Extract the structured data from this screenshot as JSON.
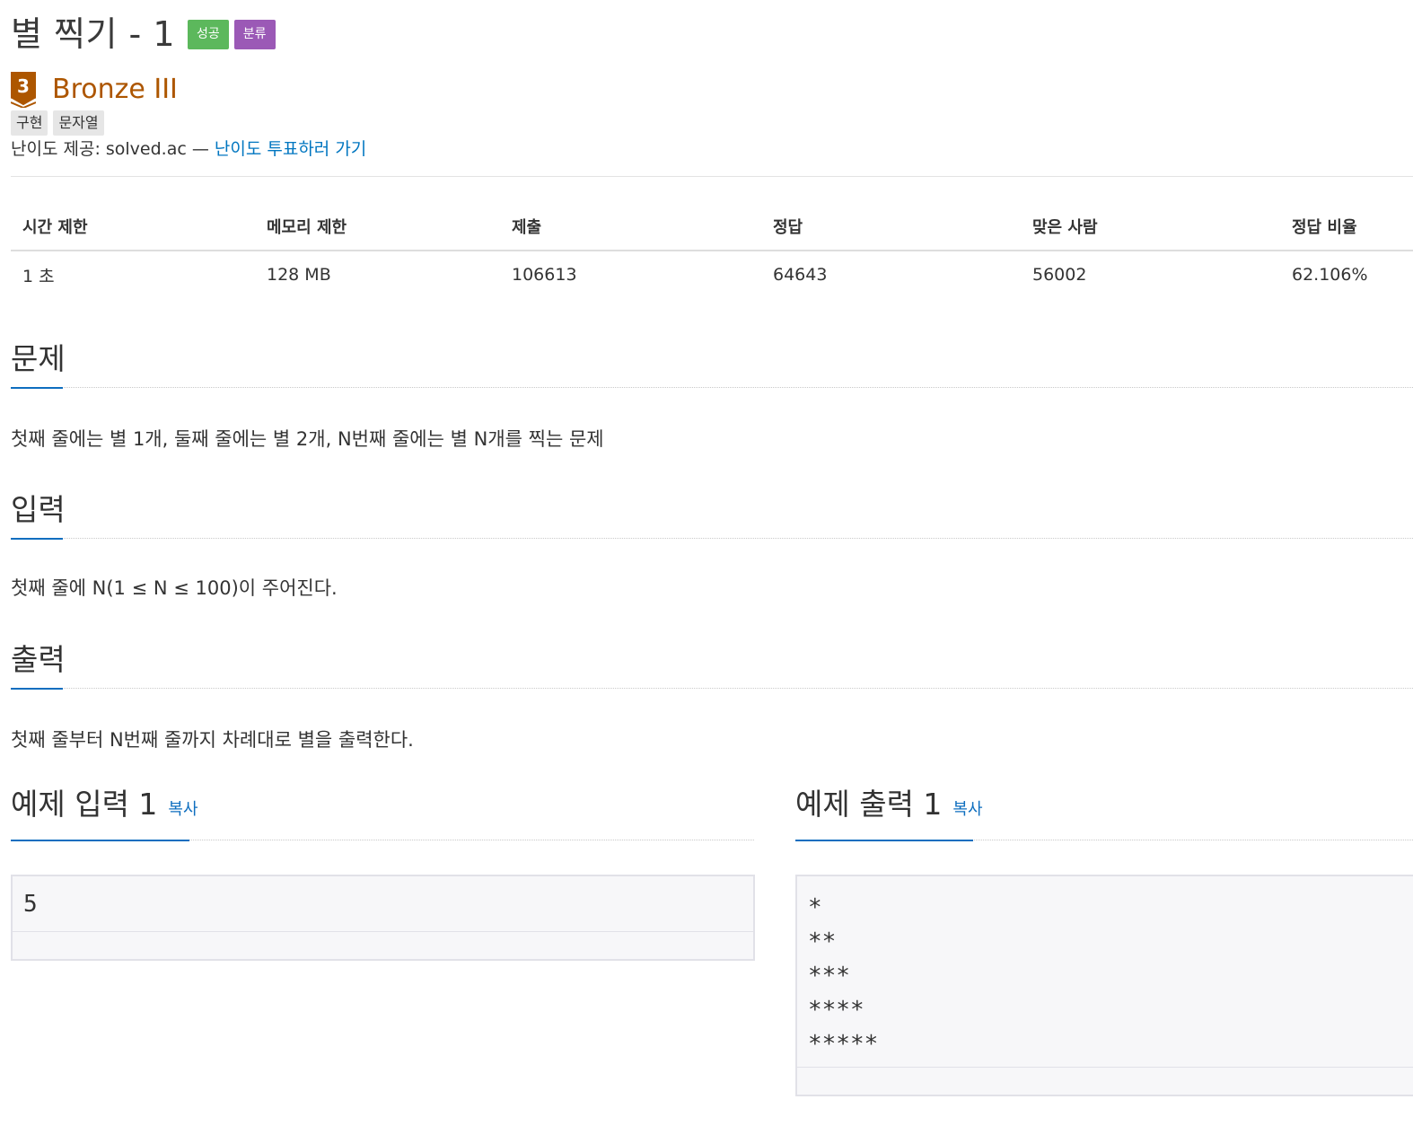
{
  "problem": {
    "title": "별 찍기 - 1",
    "badges": [
      "성공",
      "분류"
    ]
  },
  "tier": {
    "number": "3",
    "name": "Bronze III",
    "color": "#ad5600"
  },
  "tags": [
    "구현",
    "문자열"
  ],
  "provider": {
    "prefix": "난이도 제공: solved.ac — ",
    "vote_link": "난이도 투표하러 가기"
  },
  "info": {
    "headers": [
      "시간 제한",
      "메모리 제한",
      "제출",
      "정답",
      "맞은 사람",
      "정답 비율"
    ],
    "values": [
      "1 초",
      "128 MB",
      "106613",
      "64643",
      "56002",
      "62.106%"
    ]
  },
  "sections": {
    "description": {
      "title": "문제",
      "text": "첫째 줄에는 별 1개, 둘째 줄에는 별 2개, N번째 줄에는 별 N개를 찍는 문제"
    },
    "input": {
      "title": "입력",
      "text": "첫째 줄에 N(1 ≤ N ≤ 100)이 주어진다."
    },
    "output": {
      "title": "출력",
      "text": "첫째 줄부터 N번째 줄까지 차례대로 별을 출력한다."
    }
  },
  "samples": {
    "input": {
      "title": "예제 입력 1",
      "copy_label": "복사",
      "lines": [
        "5"
      ]
    },
    "output": {
      "title": "예제 출력 1",
      "copy_label": "복사",
      "lines": [
        "*",
        "**",
        "***",
        "****",
        "*****"
      ]
    }
  },
  "colors": {
    "success_badge": "#5cb85c",
    "category_badge": "#9b59b6",
    "link": "#0076c0",
    "accent_underline": "#0e6ebf"
  }
}
